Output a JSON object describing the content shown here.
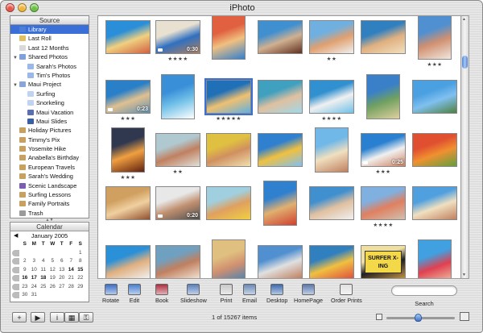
{
  "window": {
    "title": "iPhoto"
  },
  "sidebar": {
    "header": "Source",
    "items": [
      {
        "label": "Library",
        "icon": "library-icon",
        "indent": 0,
        "selected": true,
        "color": "#4b7fd6"
      },
      {
        "label": "Last Roll",
        "icon": "film-roll-icon",
        "indent": 0,
        "color": "#e0c060"
      },
      {
        "label": "Last 12 Months",
        "icon": "calendar-icon",
        "indent": 0,
        "color": "#d9d9d9"
      },
      {
        "label": "Shared Photos",
        "icon": "shared-icon",
        "indent": 0,
        "disclosure": "open",
        "color": "#7fa0d8"
      },
      {
        "label": "Sarah's Photos",
        "icon": "album-icon",
        "indent": 1,
        "color": "#9ab8e8"
      },
      {
        "label": "Tim's Photos",
        "icon": "album-icon",
        "indent": 1,
        "color": "#9ab8e8"
      },
      {
        "label": "Maui Project",
        "icon": "folder-icon",
        "indent": 0,
        "disclosure": "open",
        "color": "#8aa6d8"
      },
      {
        "label": "Surfing",
        "icon": "book-icon",
        "indent": 1,
        "color": "#c0d4f0"
      },
      {
        "label": "Snorkeling",
        "icon": "book-icon",
        "indent": 1,
        "color": "#c0d4f0"
      },
      {
        "label": "Maui Vacation",
        "icon": "book-icon",
        "indent": 1,
        "color": "#5a6fb0"
      },
      {
        "label": "Maui Slides",
        "icon": "slideshow-icon",
        "indent": 1,
        "color": "#3a5fa0"
      },
      {
        "label": "Holiday Pictures",
        "icon": "album-icon",
        "indent": 0,
        "color": "#c8a060"
      },
      {
        "label": "Timmy's Pix",
        "icon": "album-icon",
        "indent": 0,
        "color": "#c8a060"
      },
      {
        "label": "Yosemite Hike",
        "icon": "album-icon",
        "indent": 0,
        "color": "#c8a060"
      },
      {
        "label": "Anabella's Birthday",
        "icon": "album-icon",
        "indent": 0,
        "color": "#c8a060"
      },
      {
        "label": "European Travels",
        "icon": "album-icon",
        "indent": 0,
        "color": "#c8a060"
      },
      {
        "label": "Sarah's Wedding",
        "icon": "album-icon",
        "indent": 0,
        "color": "#c8a060"
      },
      {
        "label": "Scenic Landscape",
        "icon": "smart-album-icon",
        "indent": 0,
        "color": "#7a5fb0"
      },
      {
        "label": "Surfing Lessons",
        "icon": "album-icon",
        "indent": 0,
        "color": "#c8a060"
      },
      {
        "label": "Family Portraits",
        "icon": "album-icon",
        "indent": 0,
        "color": "#c8a060"
      },
      {
        "label": "Trash",
        "icon": "trash-icon",
        "indent": 0,
        "color": "#9a9a9a"
      }
    ]
  },
  "calendar": {
    "header": "Calendar",
    "month_label": "January 2005",
    "weekdays": [
      "S",
      "M",
      "T",
      "W",
      "T",
      "F",
      "S"
    ],
    "weeks": [
      [
        "",
        "",
        "",
        "",
        "",
        "",
        "1"
      ],
      [
        "2",
        "3",
        "4",
        "5",
        "6",
        "7",
        "8"
      ],
      [
        "9",
        "10",
        "11",
        "12",
        "13",
        "14",
        "15"
      ],
      [
        "16",
        "17",
        "18",
        "19",
        "20",
        "21",
        "22"
      ],
      [
        "23",
        "24",
        "25",
        "26",
        "27",
        "28",
        "29"
      ],
      [
        "30",
        "31",
        "",
        "",
        "",
        "",
        ""
      ]
    ],
    "bold_days": [
      "14",
      "15",
      "16",
      "17",
      "18"
    ]
  },
  "photos": [
    {
      "row": 0,
      "col": 0,
      "colors": [
        "#2a8fd8",
        "#f0d080",
        "#d06040"
      ]
    },
    {
      "row": 0,
      "col": 1,
      "colors": [
        "#e8e0d0",
        "#3070c0",
        "#b08060"
      ],
      "duration": "0:30",
      "stars": "★★★★"
    },
    {
      "row": 0,
      "col": 2,
      "colors": [
        "#e06040",
        "#f0c080",
        "#3080d0"
      ]
    },
    {
      "row": 0,
      "col": 3,
      "colors": [
        "#4090d0",
        "#d0b090",
        "#603020"
      ]
    },
    {
      "row": 0,
      "col": 4,
      "colors": [
        "#70b0e0",
        "#e0a070",
        "#f0f0f0"
      ],
      "stars": "★★"
    },
    {
      "row": 0,
      "col": 5,
      "colors": [
        "#3080c0",
        "#e0b080",
        "#f0e0c0"
      ]
    },
    {
      "row": 0,
      "col": 6,
      "colors": [
        "#5090d0",
        "#d09070",
        "#f0e8e0"
      ],
      "stars": "★★★"
    },
    {
      "row": 1,
      "col": 0,
      "colors": [
        "#2a80c8",
        "#e0c090",
        "#6090b0"
      ],
      "duration": "0:23",
      "stars": "★★★"
    },
    {
      "row": 1,
      "col": 1,
      "colors": [
        "#3a90d8",
        "#70c0e8",
        "#ffffff"
      ]
    },
    {
      "row": 1,
      "col": 2,
      "colors": [
        "#2070b8",
        "#f0c070",
        "#60b0e0"
      ],
      "stars": "★★★★★",
      "selected": true
    },
    {
      "row": 1,
      "col": 3,
      "colors": [
        "#40a0c0",
        "#e0c0a0",
        "#a0d8e8"
      ]
    },
    {
      "row": 1,
      "col": 4,
      "colors": [
        "#3090d0",
        "#f0f0f0",
        "#70c0e8"
      ],
      "stars": "★★★★"
    },
    {
      "row": 1,
      "col": 5,
      "colors": [
        "#3a80c8",
        "#70a060",
        "#e0d0a0"
      ]
    },
    {
      "row": 1,
      "col": 6,
      "colors": [
        "#4aa0e0",
        "#80c0f0",
        "#508040"
      ]
    },
    {
      "row": 2,
      "col": 0,
      "colors": [
        "#303850",
        "#f0a040",
        "#602010"
      ],
      "stars": "★★★"
    },
    {
      "row": 2,
      "col": 1,
      "colors": [
        "#b0c8d0",
        "#c08060",
        "#e0e0d8"
      ],
      "stars": "★★"
    },
    {
      "row": 2,
      "col": 2,
      "colors": [
        "#e0c040",
        "#d09060",
        "#f0e0b0"
      ]
    },
    {
      "row": 2,
      "col": 3,
      "colors": [
        "#3080d0",
        "#f0c040",
        "#80c0f0"
      ]
    },
    {
      "row": 2,
      "col": 4,
      "colors": [
        "#70b8e8",
        "#f0e0c0",
        "#c08060"
      ]
    },
    {
      "row": 2,
      "col": 5,
      "colors": [
        "#2a80d0",
        "#f0f0f0",
        "#d08060"
      ],
      "duration": "0:25",
      "stars": "★★★"
    },
    {
      "row": 2,
      "col": 6,
      "colors": [
        "#e05030",
        "#f09030",
        "#60a040"
      ]
    },
    {
      "row": 3,
      "col": 0,
      "colors": [
        "#d0a060",
        "#f0d0a0",
        "#905030"
      ]
    },
    {
      "row": 3,
      "col": 1,
      "colors": [
        "#e8e8e8",
        "#c09070",
        "#505050"
      ],
      "duration": "0:20"
    },
    {
      "row": 3,
      "col": 2,
      "colors": [
        "#a0d0e0",
        "#e0a060",
        "#f0d040"
      ]
    },
    {
      "row": 3,
      "col": 3,
      "colors": [
        "#3080d0",
        "#e0b070",
        "#d04030"
      ]
    },
    {
      "row": 3,
      "col": 4,
      "colors": [
        "#4090d0",
        "#e0c0a0",
        "#f0f0f0"
      ]
    },
    {
      "row": 3,
      "col": 5,
      "colors": [
        "#80b0e0",
        "#e08060",
        "#d0c0b0"
      ],
      "stars": "★★★★"
    },
    {
      "row": 3,
      "col": 6,
      "colors": [
        "#50a0e0",
        "#f0e0c0",
        "#c08060"
      ]
    },
    {
      "row": 4,
      "col": 0,
      "colors": [
        "#2a90d8",
        "#e0b080",
        "#f0f0f0"
      ]
    },
    {
      "row": 4,
      "col": 1,
      "colors": [
        "#70a0c0",
        "#c08060",
        "#f0e0d0"
      ]
    },
    {
      "row": 4,
      "col": 2,
      "colors": [
        "#e0c080",
        "#d09070",
        "#3080c0"
      ]
    },
    {
      "row": 4,
      "col": 3,
      "colors": [
        "#5090d0",
        "#e0e0e0",
        "#c08060"
      ]
    },
    {
      "row": 4,
      "col": 4,
      "colors": [
        "#3080c0",
        "#f0c040",
        "#e05040"
      ]
    },
    {
      "row": 4,
      "col": 5,
      "colors": [
        "#f0e0a0",
        "#202020",
        "#c09040"
      ],
      "sign": "SURFER X-ING"
    },
    {
      "row": 4,
      "col": 6,
      "colors": [
        "#40a0e0",
        "#e04050",
        "#f0d0b0"
      ]
    }
  ],
  "toolbar": {
    "tools": [
      {
        "label": "Rotate",
        "icon": "rotate-icon",
        "color": "#3a70c8"
      },
      {
        "label": "Edit",
        "icon": "edit-icon",
        "color": "#4a80d0"
      },
      {
        "label": "Book",
        "icon": "book-icon",
        "color": "#b03040"
      },
      {
        "label": "Slideshow",
        "icon": "slideshow-icon",
        "color": "#5a80c0"
      },
      {
        "label": "Print",
        "icon": "printer-icon",
        "color": "#c8c8c8"
      },
      {
        "label": "Email",
        "icon": "email-icon",
        "color": "#6a8ab8"
      },
      {
        "label": "Desktop",
        "icon": "desktop-icon",
        "color": "#3a6ab0"
      },
      {
        "label": "HomePage",
        "icon": "homepage-icon",
        "color": "#5a7ab0"
      },
      {
        "label": "Order Prints",
        "icon": "order-prints-icon",
        "color": "#e0e0e0"
      }
    ],
    "search_label": "Search",
    "search_value": ""
  },
  "status": {
    "count": "1 of 15267 items"
  },
  "zoom": {
    "value": 0.47
  },
  "bottom_buttons": [
    {
      "label": "+",
      "icon": "add-icon"
    },
    {
      "label": "▶",
      "icon": "play-icon"
    },
    {
      "label": "i",
      "icon": "info-icon"
    },
    {
      "label": "▦",
      "icon": "calendar-toggle-icon"
    },
    {
      "label": "⚿",
      "icon": "keyword-icon"
    }
  ],
  "colors": {
    "accent": "#3a6fd8",
    "stars": "#444444"
  }
}
